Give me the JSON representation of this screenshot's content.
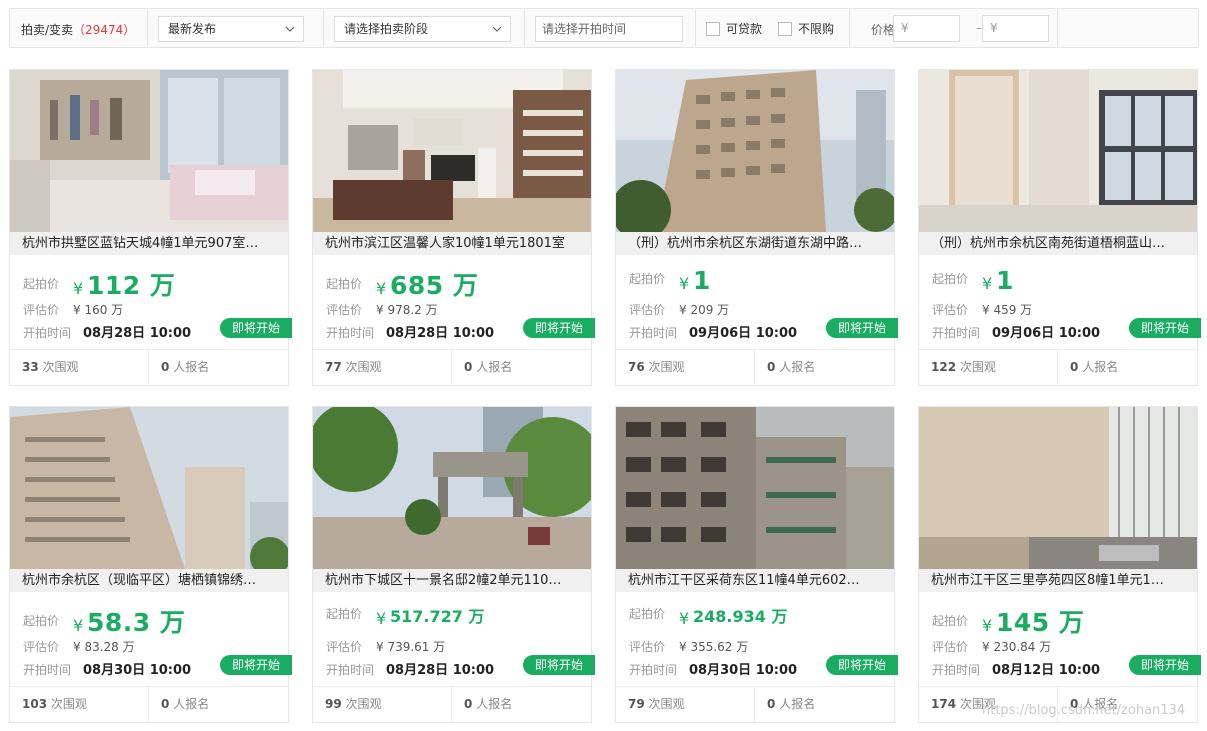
{
  "filters": {
    "category_label": "拍卖/变卖",
    "count": "（29474）",
    "sort": "最新发布",
    "stage": "请选择拍卖阶段",
    "start_time": "请选择开拍时间",
    "loan": "可贷款",
    "no_limit": "不限购",
    "price_label": "价格",
    "price_min": "¥",
    "price_max": "¥",
    "dash": "–"
  },
  "labels": {
    "start_price": "起拍价",
    "eval_price": "评估价",
    "start_time": "开拍时间",
    "yen": "¥",
    "views_suffix": "次围观",
    "signup_suffix": "人报名"
  },
  "listings": [
    {
      "title": "杭州市拱墅区蓝钻天城4幢1单元907室…",
      "price": "112",
      "unit": "万",
      "eval": "¥ 160 万",
      "time": "08月28日 10:00",
      "badge": "即将开始",
      "views": "33",
      "signups": "0",
      "image": "bedroom-photo"
    },
    {
      "title": "杭州市滨江区温馨人家10幢1单元1801室",
      "price": "685",
      "unit": "万",
      "eval": "¥ 978.2 万",
      "time": "08月28日 10:00",
      "badge": "即将开始",
      "views": "77",
      "signups": "0",
      "image": "living-room-photo"
    },
    {
      "title": "（刑）杭州市余杭区东湖街道东湖中路…",
      "price": "1",
      "unit": "",
      "eval": "¥ 209 万",
      "time": "09月06日 10:00",
      "badge": "即将开始",
      "views": "76",
      "signups": "0",
      "image": "apartment-block-photo"
    },
    {
      "title": "（刑）杭州市余杭区南苑街道梧桐蓝山…",
      "price": "1",
      "unit": "",
      "eval": "¥ 459 万",
      "time": "09月06日 10:00",
      "badge": "即将开始",
      "views": "122",
      "signups": "0",
      "image": "empty-room-photo"
    },
    {
      "title": "杭州市余杭区（现临平区）塘栖镇锦绣…",
      "price": "58.3",
      "unit": "万",
      "eval": "¥ 83.28 万",
      "time": "08月30日 10:00",
      "badge": "即将开始",
      "views": "103",
      "signups": "0",
      "image": "highrise-photo"
    },
    {
      "title": "杭州市下城区十一景名邸2幢2单元110…",
      "price": "517.727",
      "unit": "万",
      "eval": "¥ 739.61 万",
      "time": "08月28日 10:00",
      "badge": "即将开始",
      "views": "99",
      "signups": "0",
      "image": "compound-gate-photo"
    },
    {
      "title": "杭州市江干区采荷东区11幢4单元602…",
      "price": "248.934",
      "unit": "万",
      "eval": "¥ 355.62 万",
      "time": "08月30日 10:00",
      "badge": "即将开始",
      "views": "79",
      "signups": "0",
      "image": "old-building-photo"
    },
    {
      "title": "杭州市江干区三里亭苑四区8幢1单元1…",
      "price": "145",
      "unit": "万",
      "eval": "¥ 230.84 万",
      "time": "08月12日 10:00",
      "badge": "即将开始",
      "views": "174",
      "signups": "0",
      "image": "kitchen-photo"
    }
  ],
  "watermark": "https://blog.csdn.net/zohan134",
  "colors": {
    "accent": "#1aad62",
    "count": "#e4393c"
  }
}
